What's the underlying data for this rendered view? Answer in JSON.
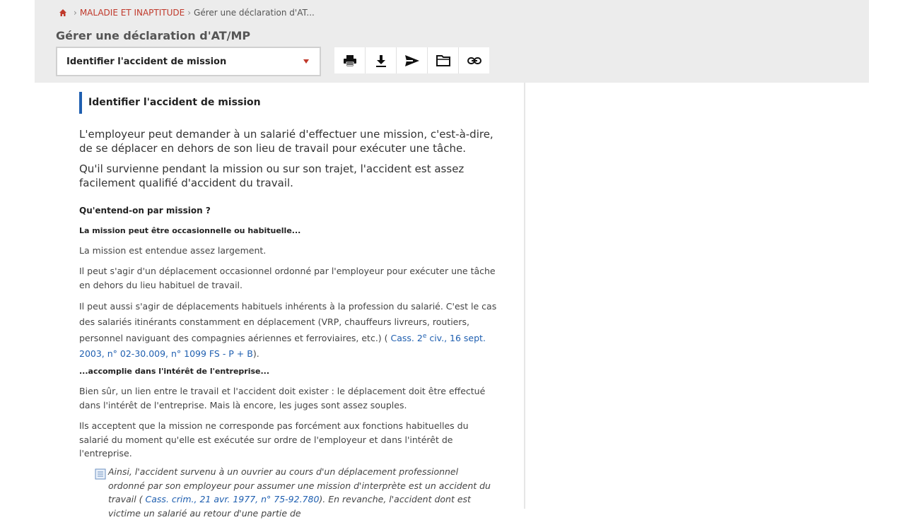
{
  "breadcrumb": {
    "section": "MALADIE ET INAPTITUDE",
    "current": "Gérer une déclaration d'AT..."
  },
  "page_title": "Gérer une déclaration d'AT/MP",
  "select": {
    "value": "Identifier l'accident de mission"
  },
  "toolbar": {
    "icons": [
      "printer-icon",
      "download-icon",
      "send-icon",
      "folder-icon",
      "link-icon"
    ]
  },
  "article": {
    "title": "Identifier l'accident de mission",
    "lead1": "L'employeur peut demander à un salarié d'effectuer une mission, c'est-à-dire, de se déplacer en dehors de son lieu de travail pour exécuter une tâche.",
    "lead2": "Qu'il survienne pendant la mission ou sur son trajet, l'accident est assez facilement qualifié d'accident du travail.",
    "h3": "Qu'entend-on par mission ?",
    "h4a": "La mission peut être occasionnelle ou habituelle...",
    "p1": "La mission est entendue assez largement.",
    "p2": "Il peut s'agir d'un déplacement occasionnel ordonné par l'employeur pour exécuter une tâche en dehors du lieu habituel de travail.",
    "p3_text": "Il peut aussi s'agir de déplacements habituels inhérents à la profession du salarié. C'est le cas des salariés itinérants constamment en déplacement (VRP, chauffeurs livreurs, routiers, personnel naviguant des compagnies aériennes et ferroviaires, etc.) ( ",
    "p3_link_a": "Cass. 2",
    "p3_link_sup": "e",
    "p3_link_b": " civ., 16 sept. 2003, n° 02-30.009, n° 1099 FS - P + B",
    "p3_end": ").",
    "h4b": "...accomplie dans l'intérêt de l'entreprise...",
    "p4": "Bien sûr, un lien entre le travail et l'accident doit exister : le déplacement doit être effectué dans l'intérêt de l'entreprise. Mais là encore, les juges sont assez souples.",
    "p5": "Ils acceptent que la mission ne corresponde pas forcément aux fonctions habituelles du salarié du moment qu'elle est exécutée sur ordre de l'employeur et dans l'intérêt de l'entreprise.",
    "note_text": "Ainsi, l'accident survenu à un ouvrier au cours d'un déplacement professionnel ordonné par son employeur pour assumer une mission d'interprète est un accident du travail ( ",
    "note_link": "Cass. crim., 21 avr. 1977, n° 75-92.780",
    "note_end": "). En revanche, l'accident dont est victime un salarié au retour d'une partie de"
  },
  "colors": {
    "accent": "#c0392b",
    "link": "#1f5fb0",
    "bar": "#1f5fb0"
  }
}
